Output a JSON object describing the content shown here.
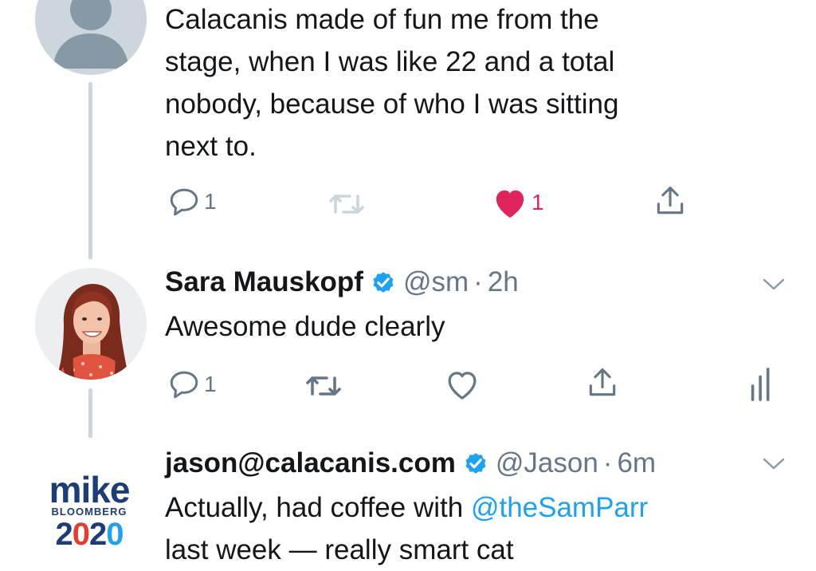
{
  "colors": {
    "text": "#14171a",
    "secondary": "#657786",
    "link": "#1da1f2",
    "like_red": "#e0245e",
    "thread_line": "#cdd6dd",
    "verified_blue": "#1da1f2"
  },
  "tweets": [
    {
      "avatar": "default-avatar",
      "lines": [
        "Calacanis made of fun me from the",
        "stage, when I was like 22 and a total",
        "nobody, because of who I was sitting",
        "next to."
      ],
      "actions": {
        "reply_count": "1",
        "retweet_count": "",
        "like_count": "1",
        "liked": true
      }
    },
    {
      "avatar": "sara-avatar",
      "display_name": "Sara Mauskopf",
      "verified": true,
      "handle": "@sm",
      "separator": "·",
      "time": "2h",
      "text": "Awesome dude clearly",
      "actions": {
        "reply_count": "1",
        "retweet_count": "",
        "like_count": "",
        "liked": false
      }
    },
    {
      "avatar": "mike-bloomberg-2020-logo",
      "logo": {
        "mike": "mike",
        "bloomberg": "BLOOMBERG",
        "year_a": "2",
        "year_b": "0",
        "year_c": "2",
        "year_d": "0"
      },
      "display_name": "jason@calacanis.com",
      "verified": true,
      "handle": "@Jason",
      "separator": "·",
      "time": "6m",
      "text_before": "Actually, had coffee with ",
      "mention": "@theSamParr",
      "line2": "last week — really smart cat"
    }
  ]
}
